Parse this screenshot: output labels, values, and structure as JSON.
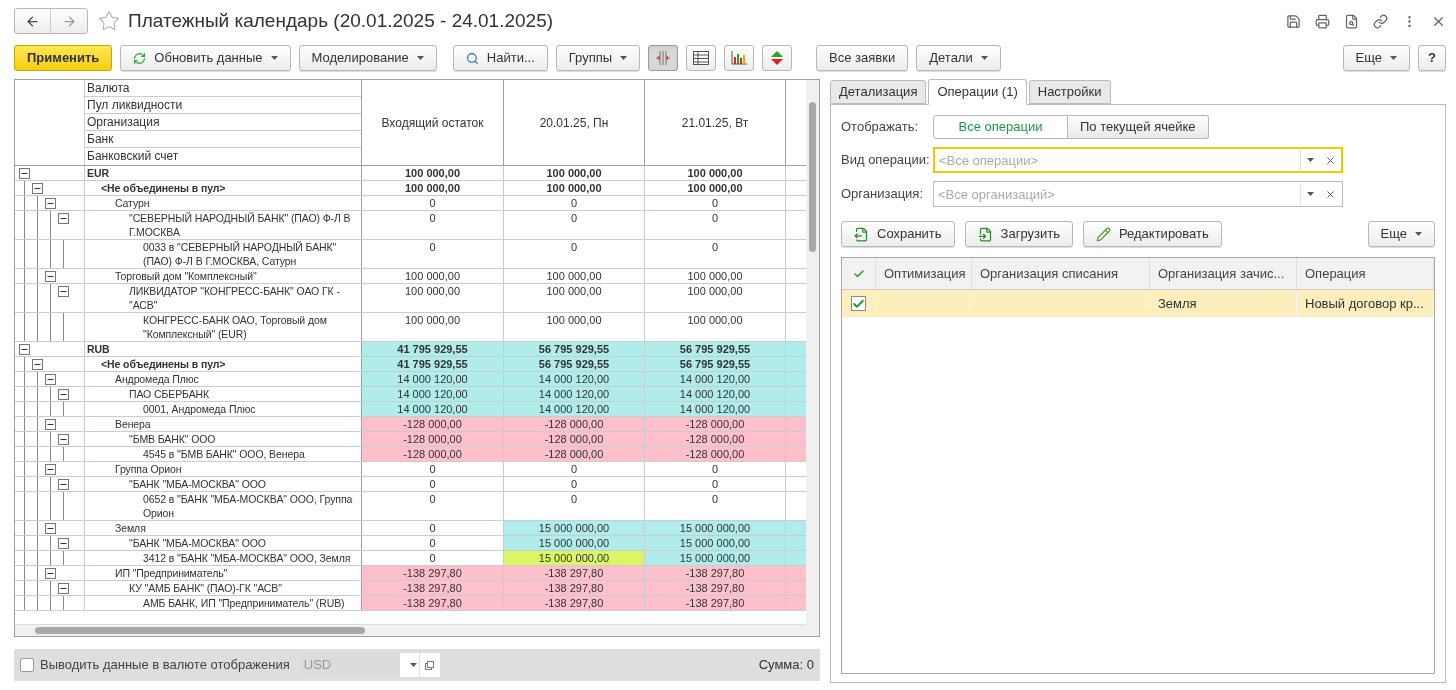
{
  "window": {
    "title": "Платежный календарь (20.01.2025 - 24.01.2025)",
    "help": "?",
    "more": "Еще"
  },
  "toolbar": [
    {
      "kind": "primary",
      "label": "Применить"
    },
    {
      "kind": "refresh",
      "label": "Обновить данные"
    },
    {
      "kind": "dropdown",
      "label": "Моделирование"
    },
    {
      "kind": "search",
      "label": "Найти..."
    },
    {
      "kind": "dropdown",
      "label": "Группы"
    },
    {
      "kind": "icon",
      "pressed": true
    },
    {
      "kind": "icon",
      "pressed": false
    },
    {
      "kind": "icon",
      "pressed": false
    },
    {
      "kind": "icon",
      "pressed": false
    },
    {
      "kind": "plain",
      "label": "Все заявки"
    },
    {
      "kind": "dropdown",
      "label": "Детали"
    }
  ],
  "grid": {
    "hierarchy": [
      "Валюта",
      "Пул ликвидности",
      "Организация",
      "Банк",
      "Банковский счет"
    ],
    "columns": [
      "Входящий остаток",
      "20.01.25, Пн",
      "21.01.25, Вт"
    ],
    "rows": [
      {
        "label": "EUR",
        "cells": [
          {
            "text": "100 000,00",
            "color": "#ffffff"
          },
          {
            "text": "100 000,00",
            "color": "#ffffff"
          },
          {
            "text": "100 000,00",
            "color": "#ffffff"
          }
        ],
        "children": [
          {
            "label": "<Не объединены в пул>",
            "cells": [
              {
                "text": "100 000,00",
                "color": "#ffffff"
              },
              {
                "text": "100 000,00",
                "color": "#ffffff"
              },
              {
                "text": "100 000,00",
                "color": "#ffffff"
              }
            ],
            "children": [
              {
                "label": "Сатурн",
                "cells": [
                  {
                    "text": "0",
                    "color": "#ffffff"
                  },
                  {
                    "text": "0",
                    "color": "#ffffff"
                  },
                  {
                    "text": "0",
                    "color": "#ffffff"
                  }
                ],
                "children": [
                  {
                    "label": "\"СЕВЕРНЫЙ НАРОДНЫЙ БАНК\" (ПАО) Ф-Л В Г.МОСКВА",
                    "cells": [
                      {
                        "text": "0",
                        "color": "#ffffff"
                      },
                      {
                        "text": "0",
                        "color": "#ffffff"
                      },
                      {
                        "text": "0",
                        "color": "#ffffff"
                      }
                    ],
                    "children": [
                      {
                        "label": "0033 в \"СЕВЕРНЫЙ НАРОДНЫЙ БАНК\" (ПАО) Ф-Л В Г.МОСКВА, Сатурн",
                        "cells": [
                          {
                            "text": "0",
                            "color": "#ffffff"
                          },
                          {
                            "text": "0",
                            "color": "#ffffff"
                          },
                          {
                            "text": "0",
                            "color": "#ffffff"
                          }
                        ]
                      }
                    ]
                  }
                ]
              },
              {
                "label": "Торговый дом \"Комплексный\"",
                "cells": [
                  {
                    "text": "100 000,00",
                    "color": "#ffffff"
                  },
                  {
                    "text": "100 000,00",
                    "color": "#ffffff"
                  },
                  {
                    "text": "100 000,00",
                    "color": "#ffffff"
                  }
                ],
                "children": [
                  {
                    "label": "ЛИКВИДАТОР \"КОНГРЕСС-БАНК\" ОАО ГК - \"АСВ\"",
                    "cells": [
                      {
                        "text": "100 000,00",
                        "color": "#ffffff"
                      },
                      {
                        "text": "100 000,00",
                        "color": "#ffffff"
                      },
                      {
                        "text": "100 000,00",
                        "color": "#ffffff"
                      }
                    ],
                    "children": [
                      {
                        "label": "КОНГРЕСС-БАНК ОАО, Торговый дом \"Комплексный\" (EUR)",
                        "cells": [
                          {
                            "text": "100 000,00",
                            "color": "#ffffff"
                          },
                          {
                            "text": "100 000,00",
                            "color": "#ffffff"
                          },
                          {
                            "text": "100 000,00",
                            "color": "#ffffff"
                          }
                        ]
                      }
                    ]
                  }
                ]
              }
            ]
          }
        ]
      },
      {
        "label": "RUB",
        "cells": [
          {
            "text": "41 795 929,55",
            "color": "#b0ecea"
          },
          {
            "text": "56 795 929,55",
            "color": "#b0ecea"
          },
          {
            "text": "56 795 929,55",
            "color": "#b0ecea"
          }
        ],
        "children": [
          {
            "label": "<Не объединены в пул>",
            "cells": [
              {
                "text": "41 795 929,55",
                "color": "#b0ecea"
              },
              {
                "text": "56 795 929,55",
                "color": "#b0ecea"
              },
              {
                "text": "56 795 929,55",
                "color": "#b0ecea"
              }
            ],
            "children": [
              {
                "label": "Андромеда Плюс",
                "cells": [
                  {
                    "text": "14 000 120,00",
                    "color": "#b0ecea"
                  },
                  {
                    "text": "14 000 120,00",
                    "color": "#b0ecea"
                  },
                  {
                    "text": "14 000 120,00",
                    "color": "#b0ecea"
                  }
                ],
                "children": [
                  {
                    "label": "ПАО СБЕРБАНК",
                    "cells": [
                      {
                        "text": "14 000 120,00",
                        "color": "#b0ecea"
                      },
                      {
                        "text": "14 000 120,00",
                        "color": "#b0ecea"
                      },
                      {
                        "text": "14 000 120,00",
                        "color": "#b0ecea"
                      }
                    ],
                    "children": [
                      {
                        "label": "0001, Андромеда Плюс",
                        "cells": [
                          {
                            "text": "14 000 120,00",
                            "color": "#b0ecea"
                          },
                          {
                            "text": "14 000 120,00",
                            "color": "#b0ecea"
                          },
                          {
                            "text": "14 000 120,00",
                            "color": "#b0ecea"
                          }
                        ]
                      }
                    ]
                  }
                ]
              },
              {
                "label": "Венера",
                "cells": [
                  {
                    "text": "-128 000,00",
                    "color": "#ffc0cb"
                  },
                  {
                    "text": "-128 000,00",
                    "color": "#ffc0cb"
                  },
                  {
                    "text": "-128 000,00",
                    "color": "#ffc0cb"
                  }
                ],
                "children": [
                  {
                    "label": "\"БМВ БАНК\" ООО",
                    "cells": [
                      {
                        "text": "-128 000,00",
                        "color": "#ffc0cb"
                      },
                      {
                        "text": "-128 000,00",
                        "color": "#ffc0cb"
                      },
                      {
                        "text": "-128 000,00",
                        "color": "#ffc0cb"
                      }
                    ],
                    "children": [
                      {
                        "label": "4545 в \"БМВ БАНК\" ООО, Венера",
                        "cells": [
                          {
                            "text": "-128 000,00",
                            "color": "#ffc0cb"
                          },
                          {
                            "text": "-128 000,00",
                            "color": "#ffc0cb"
                          },
                          {
                            "text": "-128 000,00",
                            "color": "#ffc0cb"
                          }
                        ]
                      }
                    ]
                  }
                ]
              },
              {
                "label": "Группа Орион",
                "cells": [
                  {
                    "text": "0",
                    "color": "#ffffff"
                  },
                  {
                    "text": "0",
                    "color": "#ffffff"
                  },
                  {
                    "text": "0",
                    "color": "#ffffff"
                  }
                ],
                "children": [
                  {
                    "label": "\"БАНК \"МБА-МОСКВА\" ООО",
                    "cells": [
                      {
                        "text": "0",
                        "color": "#ffffff"
                      },
                      {
                        "text": "0",
                        "color": "#ffffff"
                      },
                      {
                        "text": "0",
                        "color": "#ffffff"
                      }
                    ],
                    "children": [
                      {
                        "label": "0652 в \"БАНК \"МБА-МОСКВА\" ООО, Группа Орион",
                        "cells": [
                          {
                            "text": "0",
                            "color": "#ffffff"
                          },
                          {
                            "text": "0",
                            "color": "#ffffff"
                          },
                          {
                            "text": "0",
                            "color": "#ffffff"
                          }
                        ]
                      }
                    ]
                  }
                ]
              },
              {
                "label": "Земля",
                "cells": [
                  {
                    "text": "0",
                    "color": "#ffffff"
                  },
                  {
                    "text": "15 000 000,00",
                    "color": "#b0ecea"
                  },
                  {
                    "text": "15 000 000,00",
                    "color": "#b0ecea"
                  }
                ],
                "children": [
                  {
                    "label": "\"БАНК \"МБА-МОСКВА\" ООО",
                    "cells": [
                      {
                        "text": "0",
                        "color": "#ffffff"
                      },
                      {
                        "text": "15 000 000,00",
                        "color": "#b0ecea"
                      },
                      {
                        "text": "15 000 000,00",
                        "color": "#b0ecea"
                      }
                    ],
                    "children": [
                      {
                        "label": "3412 в \"БАНК \"МБА-МОСКВА\" ООО, Земля",
                        "cells": [
                          {
                            "text": "0",
                            "color": "#ffffff"
                          },
                          {
                            "text": "15 000 000,00",
                            "color": "#dcf564"
                          },
                          {
                            "text": "15 000 000,00",
                            "color": "#b0ecea"
                          }
                        ]
                      }
                    ]
                  }
                ]
              },
              {
                "label": "ИП \"Предприниматель\"",
                "cells": [
                  {
                    "text": "-138 297,80",
                    "color": "#ffc0cb"
                  },
                  {
                    "text": "-138 297,80",
                    "color": "#ffc0cb"
                  },
                  {
                    "text": "-138 297,80",
                    "color": "#ffc0cb"
                  }
                ],
                "children": [
                  {
                    "label": "КУ \"АМБ БАНК\" (ПАО)-ГК \"АСВ\"",
                    "cells": [
                      {
                        "text": "-138 297,80",
                        "color": "#ffc0cb"
                      },
                      {
                        "text": "-138 297,80",
                        "color": "#ffc0cb"
                      },
                      {
                        "text": "-138 297,80",
                        "color": "#ffc0cb"
                      }
                    ],
                    "children": [
                      {
                        "label": "АМБ БАНК, ИП \"Предприниматель\" (RUB)",
                        "cells": [
                          {
                            "text": "-138 297,80",
                            "color": "#ffc0cb"
                          },
                          {
                            "text": "-138 297,80",
                            "color": "#ffc0cb"
                          },
                          {
                            "text": "-138 297,80",
                            "color": "#ffc0cb"
                          }
                        ]
                      }
                    ]
                  }
                ]
              }
            ]
          }
        ]
      }
    ]
  },
  "footer": {
    "checkbox": {
      "label": "Выводить данные в валюте отображения",
      "checked": false
    },
    "currency": {
      "value": "USD",
      "disabled": true
    },
    "sum": "Сумма: 0"
  },
  "panel": {
    "tabs": [
      {
        "label": "Детализация",
        "selected": false
      },
      {
        "label": "Операции (1)",
        "selected": true
      },
      {
        "label": "Настройки",
        "selected": false
      }
    ],
    "display": {
      "label": "Отображать:",
      "options": [
        {
          "label": "Все операции",
          "selected": true
        },
        {
          "label": "По текущей ячейке",
          "selected": false
        }
      ]
    },
    "fields": [
      {
        "label": "Вид операции:",
        "placeholder": "<Все операции>",
        "focused": true
      },
      {
        "label": "Организация:",
        "placeholder": "<Все организаций>",
        "focused": false
      }
    ],
    "actions": [
      {
        "kind": "save",
        "label": "Сохранить"
      },
      {
        "kind": "load",
        "label": "Загрузить"
      },
      {
        "kind": "edit",
        "label": "Редактировать"
      }
    ],
    "more": "Еще",
    "table": {
      "columns": [
        "Оптимизация",
        "Организация списания",
        "Организация зачис...",
        "Операция"
      ],
      "rows": [
        {
          "selected": true,
          "checked": true,
          "cells": [
            "",
            "",
            "Земля",
            "Новый договор кр..."
          ]
        }
      ]
    }
  }
}
